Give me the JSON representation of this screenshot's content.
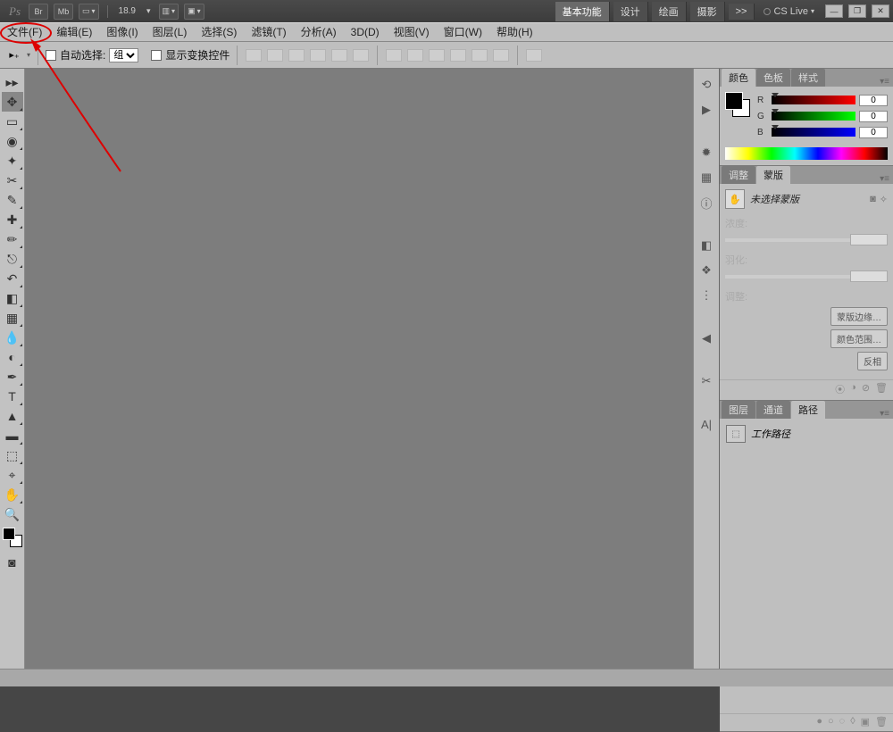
{
  "titlebar": {
    "zoom": "18.9",
    "workspaces": [
      "基本功能",
      "设计",
      "绘画",
      "摄影"
    ],
    "more": ">>",
    "cslive": "CS Live"
  },
  "menu": [
    "文件(F)",
    "编辑(E)",
    "图像(I)",
    "图层(L)",
    "选择(S)",
    "滤镜(T)",
    "分析(A)",
    "3D(D)",
    "视图(V)",
    "窗口(W)",
    "帮助(H)"
  ],
  "options": {
    "auto_select": "自动选择:",
    "group": "组",
    "show_transform": "显示变换控件"
  },
  "panels": {
    "color_tabs": [
      "颜色",
      "色板",
      "样式"
    ],
    "rgb": {
      "r": "0",
      "g": "0",
      "b": "0"
    },
    "mask_tabs": [
      "调整",
      "蒙版"
    ],
    "mask_title": "未选择蒙版",
    "mask_section1": "浓度:",
    "mask_section2": "羽化:",
    "mask_section3": "调整:",
    "refine_edge": "蒙版边缘…",
    "color_range": "颜色范围…",
    "invert": "反相",
    "paths_tabs": [
      "图层",
      "通道",
      "路径"
    ],
    "work_path": "工作路径"
  }
}
